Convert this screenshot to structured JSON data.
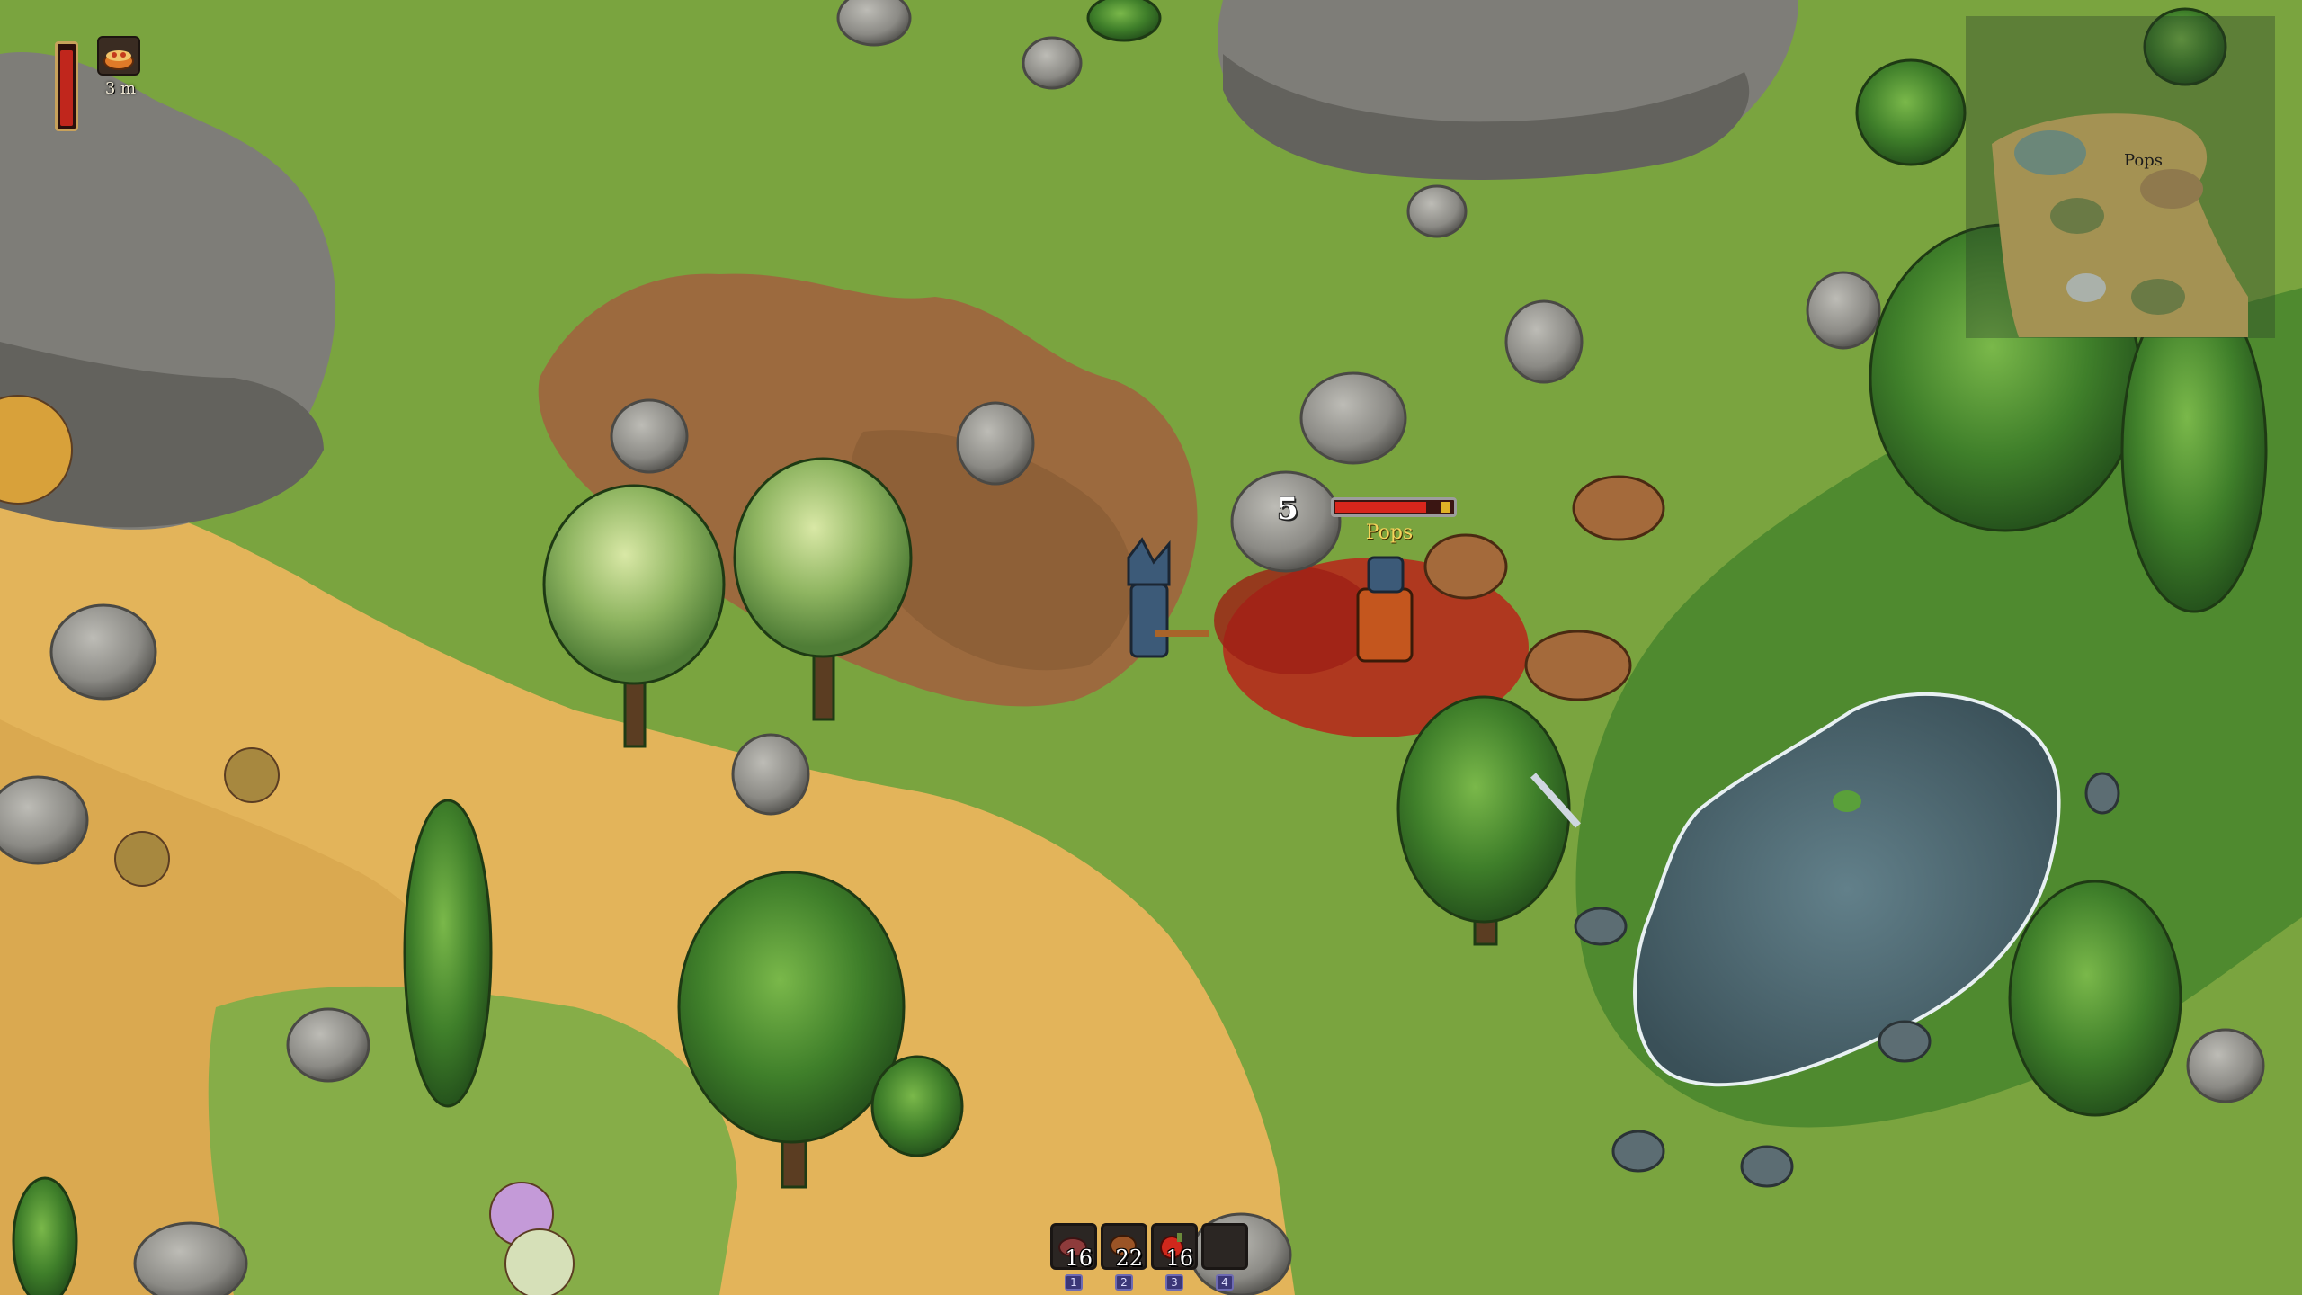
{
  "hud": {
    "health_fraction": 0.95,
    "buff": {
      "icon": "food-bowl-icon",
      "timer": "3 m"
    }
  },
  "minimap": {
    "player_label": "Pops"
  },
  "target": {
    "level": "5",
    "name": "Pops",
    "health_fraction": 0.78
  },
  "hotbar": {
    "slots": [
      {
        "icon": "raw-meat-icon",
        "count": "16",
        "key": "1"
      },
      {
        "icon": "cooked-meat-icon",
        "count": "22",
        "key": "2"
      },
      {
        "icon": "red-potion-icon",
        "count": "16",
        "key": "3"
      },
      {
        "icon": "empty-slot",
        "count": "",
        "key": "4"
      }
    ]
  },
  "colors": {
    "grass": "#7aa43f",
    "dark_grass": "#4f8a2f",
    "sand": "#e7b95a",
    "dirt": "#9c6a3e",
    "rock": "#8d8c86",
    "water": "#4f6772",
    "blood": "#b8261a",
    "health": "#c0261c"
  }
}
